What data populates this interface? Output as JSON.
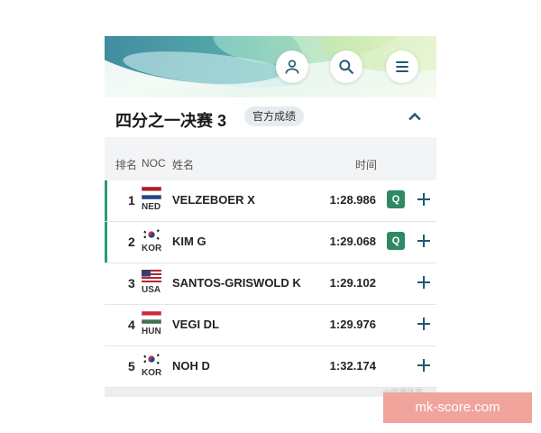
{
  "header": {
    "title": "四分之一决赛 3",
    "badge": "官方成绩",
    "icons": {
      "profile": "person-icon",
      "search": "search-icon",
      "menu": "menu-icon",
      "collapse": "chevron-up-icon"
    }
  },
  "columns": {
    "rank": "排名",
    "noc": "NOC",
    "name": "姓名",
    "time": "时间"
  },
  "rows": [
    {
      "rank": "1",
      "noc": "NED",
      "name": "VELZEBOER X",
      "time": "1:28.986",
      "qualified": "Q"
    },
    {
      "rank": "2",
      "noc": "KOR",
      "name": "KIM G",
      "time": "1:29.068",
      "qualified": "Q"
    },
    {
      "rank": "3",
      "noc": "USA",
      "name": "SANTOS-GRISWOLD K",
      "time": "1:29.102",
      "qualified": ""
    },
    {
      "rank": "4",
      "noc": "HUN",
      "name": "VEGI DL",
      "time": "1:29.976",
      "qualified": ""
    },
    {
      "rank": "5",
      "noc": "KOR",
      "name": "NOH D",
      "time": "1:32.174",
      "qualified": ""
    }
  ],
  "colors": {
    "accent": "#2a9d6f",
    "q_badge": "#2f8a63",
    "site_bg": "#f0a49c"
  },
  "watermark": "@微博体育",
  "site_label": "mk-score.com"
}
